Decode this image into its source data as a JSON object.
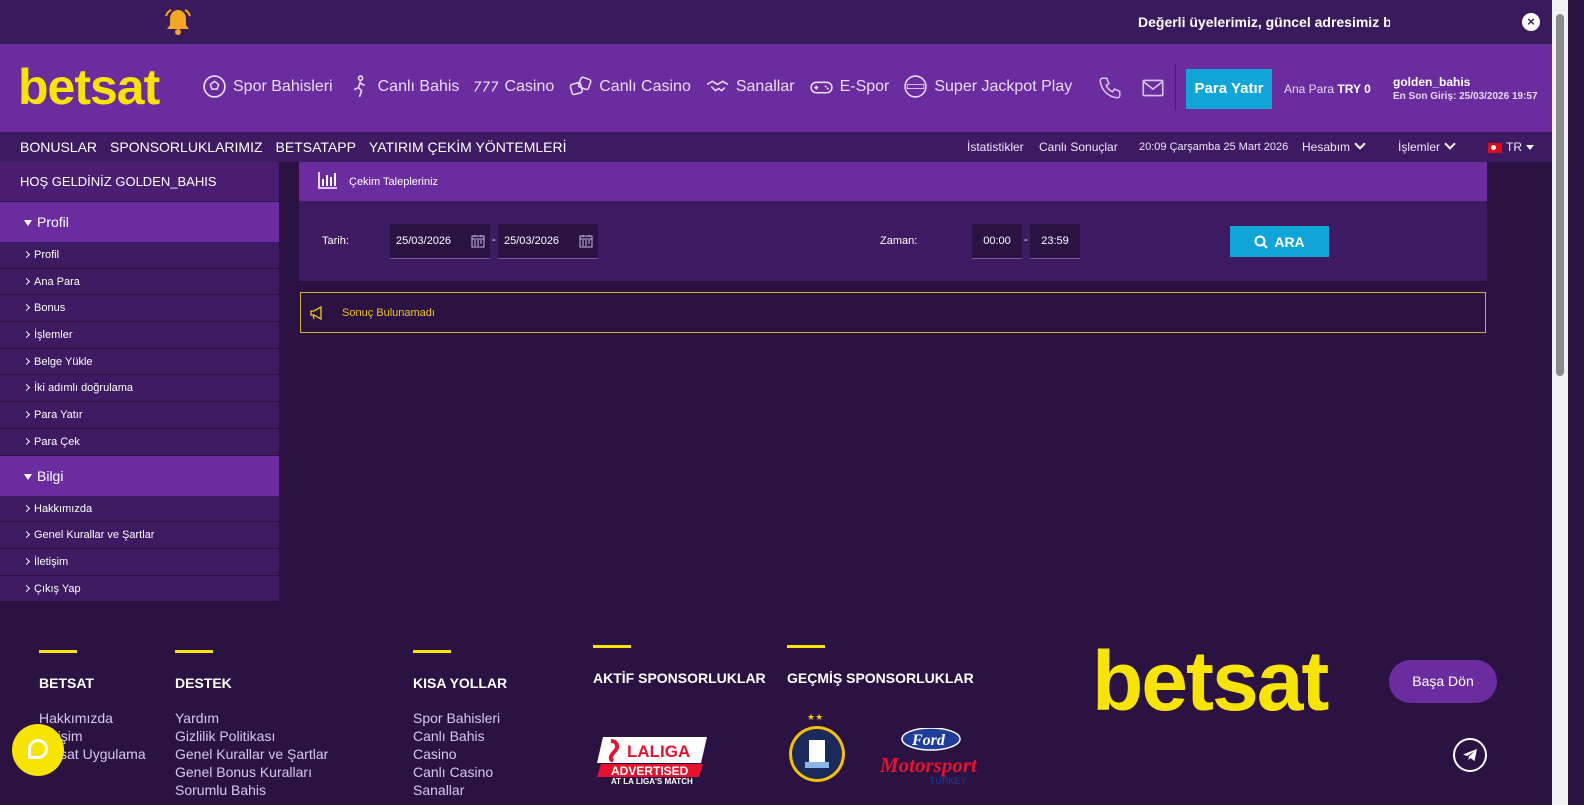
{
  "notice": {
    "message": "Değerli üyelerimiz, güncel adresimiz betsat",
    "close": "×"
  },
  "header": {
    "logo": "betsat",
    "nav": [
      {
        "label": "Spor Bahisleri",
        "icon": "soccer-ball-icon"
      },
      {
        "label": "Canlı Bahis",
        "icon": "player-icon"
      },
      {
        "label": "Casino",
        "icon": "slot-777-icon"
      },
      {
        "label": "Canlı Casino",
        "icon": "dice-icon"
      },
      {
        "label": "Sanallar",
        "icon": "handshake-icon"
      },
      {
        "label": "E-Spor",
        "icon": "gamepad-icon"
      },
      {
        "label": "Super Jackpot Play",
        "icon": "jackpot-icon"
      }
    ],
    "deposit_label": "Para Yatır",
    "balance_label": "Ana Para",
    "balance_value": "TRY 0",
    "username": "golden_bahis",
    "last_login": "En Son Giriş: 25/03/2026 19:57"
  },
  "subnav": {
    "left": [
      "BONUSLAR",
      "SPONSORLUKLARIMIZ",
      "BETSATAPP",
      "YATIRIM ÇEKİM YÖNTEMLERİ"
    ],
    "stats": "İstatistikler",
    "live_results": "Canlı Sonuçlar",
    "datetime": "20:09 Çarşamba 25 Mart 2026",
    "account": "Hesabım",
    "transactions": "İşlemler",
    "lang": "TR"
  },
  "sidebar": {
    "welcome": "HOŞ GELDİNİZ GOLDEN_BAHIS",
    "sections": [
      {
        "title": "Profil",
        "items": [
          "Profil",
          "Ana Para",
          "Bonus",
          "İşlemler",
          "Belge Yükle",
          "İki adımlı doğrulama",
          "Para Yatır",
          "Para Çek"
        ]
      },
      {
        "title": "Bilgi",
        "items": [
          "Hakkımızda",
          "Genel Kurallar ve Şartlar",
          "İletişim",
          "Çıkış Yap"
        ]
      }
    ]
  },
  "main": {
    "title": "Çekim Talepleriniz",
    "date_label": "Tarih:",
    "date_from": "25/03/2026",
    "date_to": "25/03/2026",
    "time_label": "Zaman:",
    "time_from": "00:00",
    "time_to": "23:59",
    "search_label": "ARA",
    "dash": "-",
    "no_result": "Sonuç Bulunamadı"
  },
  "footer": {
    "columns": [
      {
        "title": "BETSAT",
        "links": [
          "Hakkımızda",
          "İletişim",
          "Betsat Uygulama"
        ]
      },
      {
        "title": "DESTEK",
        "links": [
          "Yardım",
          "Gizlilik Politikası",
          "Genel Kurallar ve Şartlar",
          "Genel Bonus Kuralları",
          "Sorumlu Bahis"
        ]
      },
      {
        "title": "KISA YOLLAR",
        "links": [
          "Spor Bahisleri",
          "Canlı Bahis",
          "Casino",
          "Canlı Casino",
          "Sanallar"
        ]
      },
      {
        "title": "AKTİF SPONSORLUKLAR",
        "links": []
      },
      {
        "title": "GEÇMİŞ SPONSORLUKLAR",
        "links": []
      }
    ],
    "logo": "betsat",
    "back_to_top": "Başa Dön",
    "laliga_top": "LALIGA",
    "laliga_mid": "ADVERTISED",
    "laliga_bottom": "AT LA LIGA'S MATCH",
    "ford_name": "Ford",
    "ford_sub": "Motorsport",
    "ford_country": "TURKEY"
  },
  "colors": {
    "brand_yellow": "#f7e400",
    "header_purple": "#6a2c9e",
    "accent_blue": "#0fa5d6",
    "background": "#2a1343"
  }
}
